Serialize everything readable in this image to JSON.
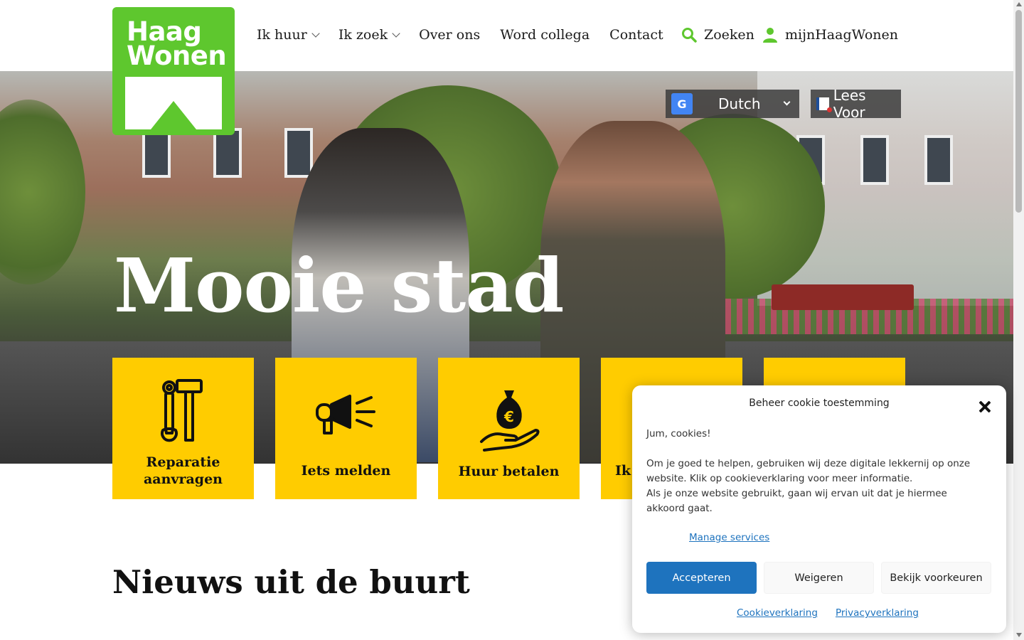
{
  "brand": {
    "name_line1": "Haag",
    "name_line2": "Wonen",
    "color": "#5ec72e"
  },
  "nav": {
    "items": [
      {
        "label": "Ik huur",
        "has_dropdown": true
      },
      {
        "label": "Ik zoek",
        "has_dropdown": true
      },
      {
        "label": "Over ons",
        "has_dropdown": false
      },
      {
        "label": "Word collega",
        "has_dropdown": false
      },
      {
        "label": "Contact",
        "has_dropdown": false
      }
    ],
    "search_label": "Zoeken",
    "account_label": "mijnHaagWonen"
  },
  "hero": {
    "title": "Mooie stad",
    "language_selected": "Dutch",
    "read_aloud_label": "Lees Voor"
  },
  "tiles": [
    {
      "label_line1": "Reparatie",
      "label_line2": "aanvragen",
      "icon": "tools-icon"
    },
    {
      "label_line1": "Iets melden",
      "label_line2": "",
      "icon": "megaphone-icon"
    },
    {
      "label_line1": "Huur betalen",
      "label_line2": "",
      "icon": "money-bag-hand-icon"
    },
    {
      "label_line1": "Ik",
      "label_line2": "",
      "icon": ""
    },
    {
      "label_line1": "",
      "label_line2": "",
      "icon": ""
    }
  ],
  "tile_color": "#ffcc00",
  "news": {
    "title": "Nieuws uit de buurt"
  },
  "cookie": {
    "title": "Beheer cookie toestemming",
    "greeting": "Jum, cookies!",
    "text1": "Om je goed te helpen, gebruiken wij deze digitale lekkernij op onze website. Klik op cookieverklaring voor meer informatie.",
    "text2": "Als je onze website gebruikt, gaan wij ervan uit dat je hiermee akkoord gaat.",
    "manage_link": "Manage services",
    "accept": "Accepteren",
    "deny": "Weigeren",
    "preferences": "Bekijk voorkeuren",
    "cookie_statement": "Cookieverklaring",
    "privacy_statement": "Privacyverklaring",
    "accent": "#1e73be"
  }
}
